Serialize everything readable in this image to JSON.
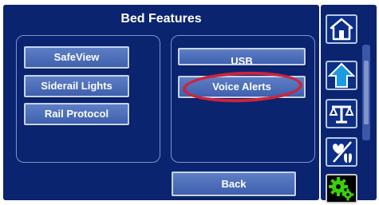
{
  "header": {
    "title": "Bed Features"
  },
  "left_panel": {
    "buttons": [
      {
        "label": "SafeView"
      },
      {
        "label": "Siderail Lights"
      },
      {
        "label": "Rail Protocol"
      }
    ]
  },
  "right_panel": {
    "buttons": [
      {
        "label": "USB"
      },
      {
        "label": "Voice Alerts"
      }
    ]
  },
  "footer": {
    "back_label": "Back"
  },
  "sidebar": {
    "items": [
      {
        "icon": "home-icon"
      },
      {
        "icon": "up-arrow-icon"
      },
      {
        "icon": "scale-icon"
      },
      {
        "icon": "heart-lungs-icon"
      },
      {
        "icon": "gears-icon"
      }
    ]
  },
  "colors": {
    "background": "#0b2470",
    "button": "#4b6cb7",
    "highlight_oval": "#d0233a",
    "gear_green": "#3ad10b"
  }
}
